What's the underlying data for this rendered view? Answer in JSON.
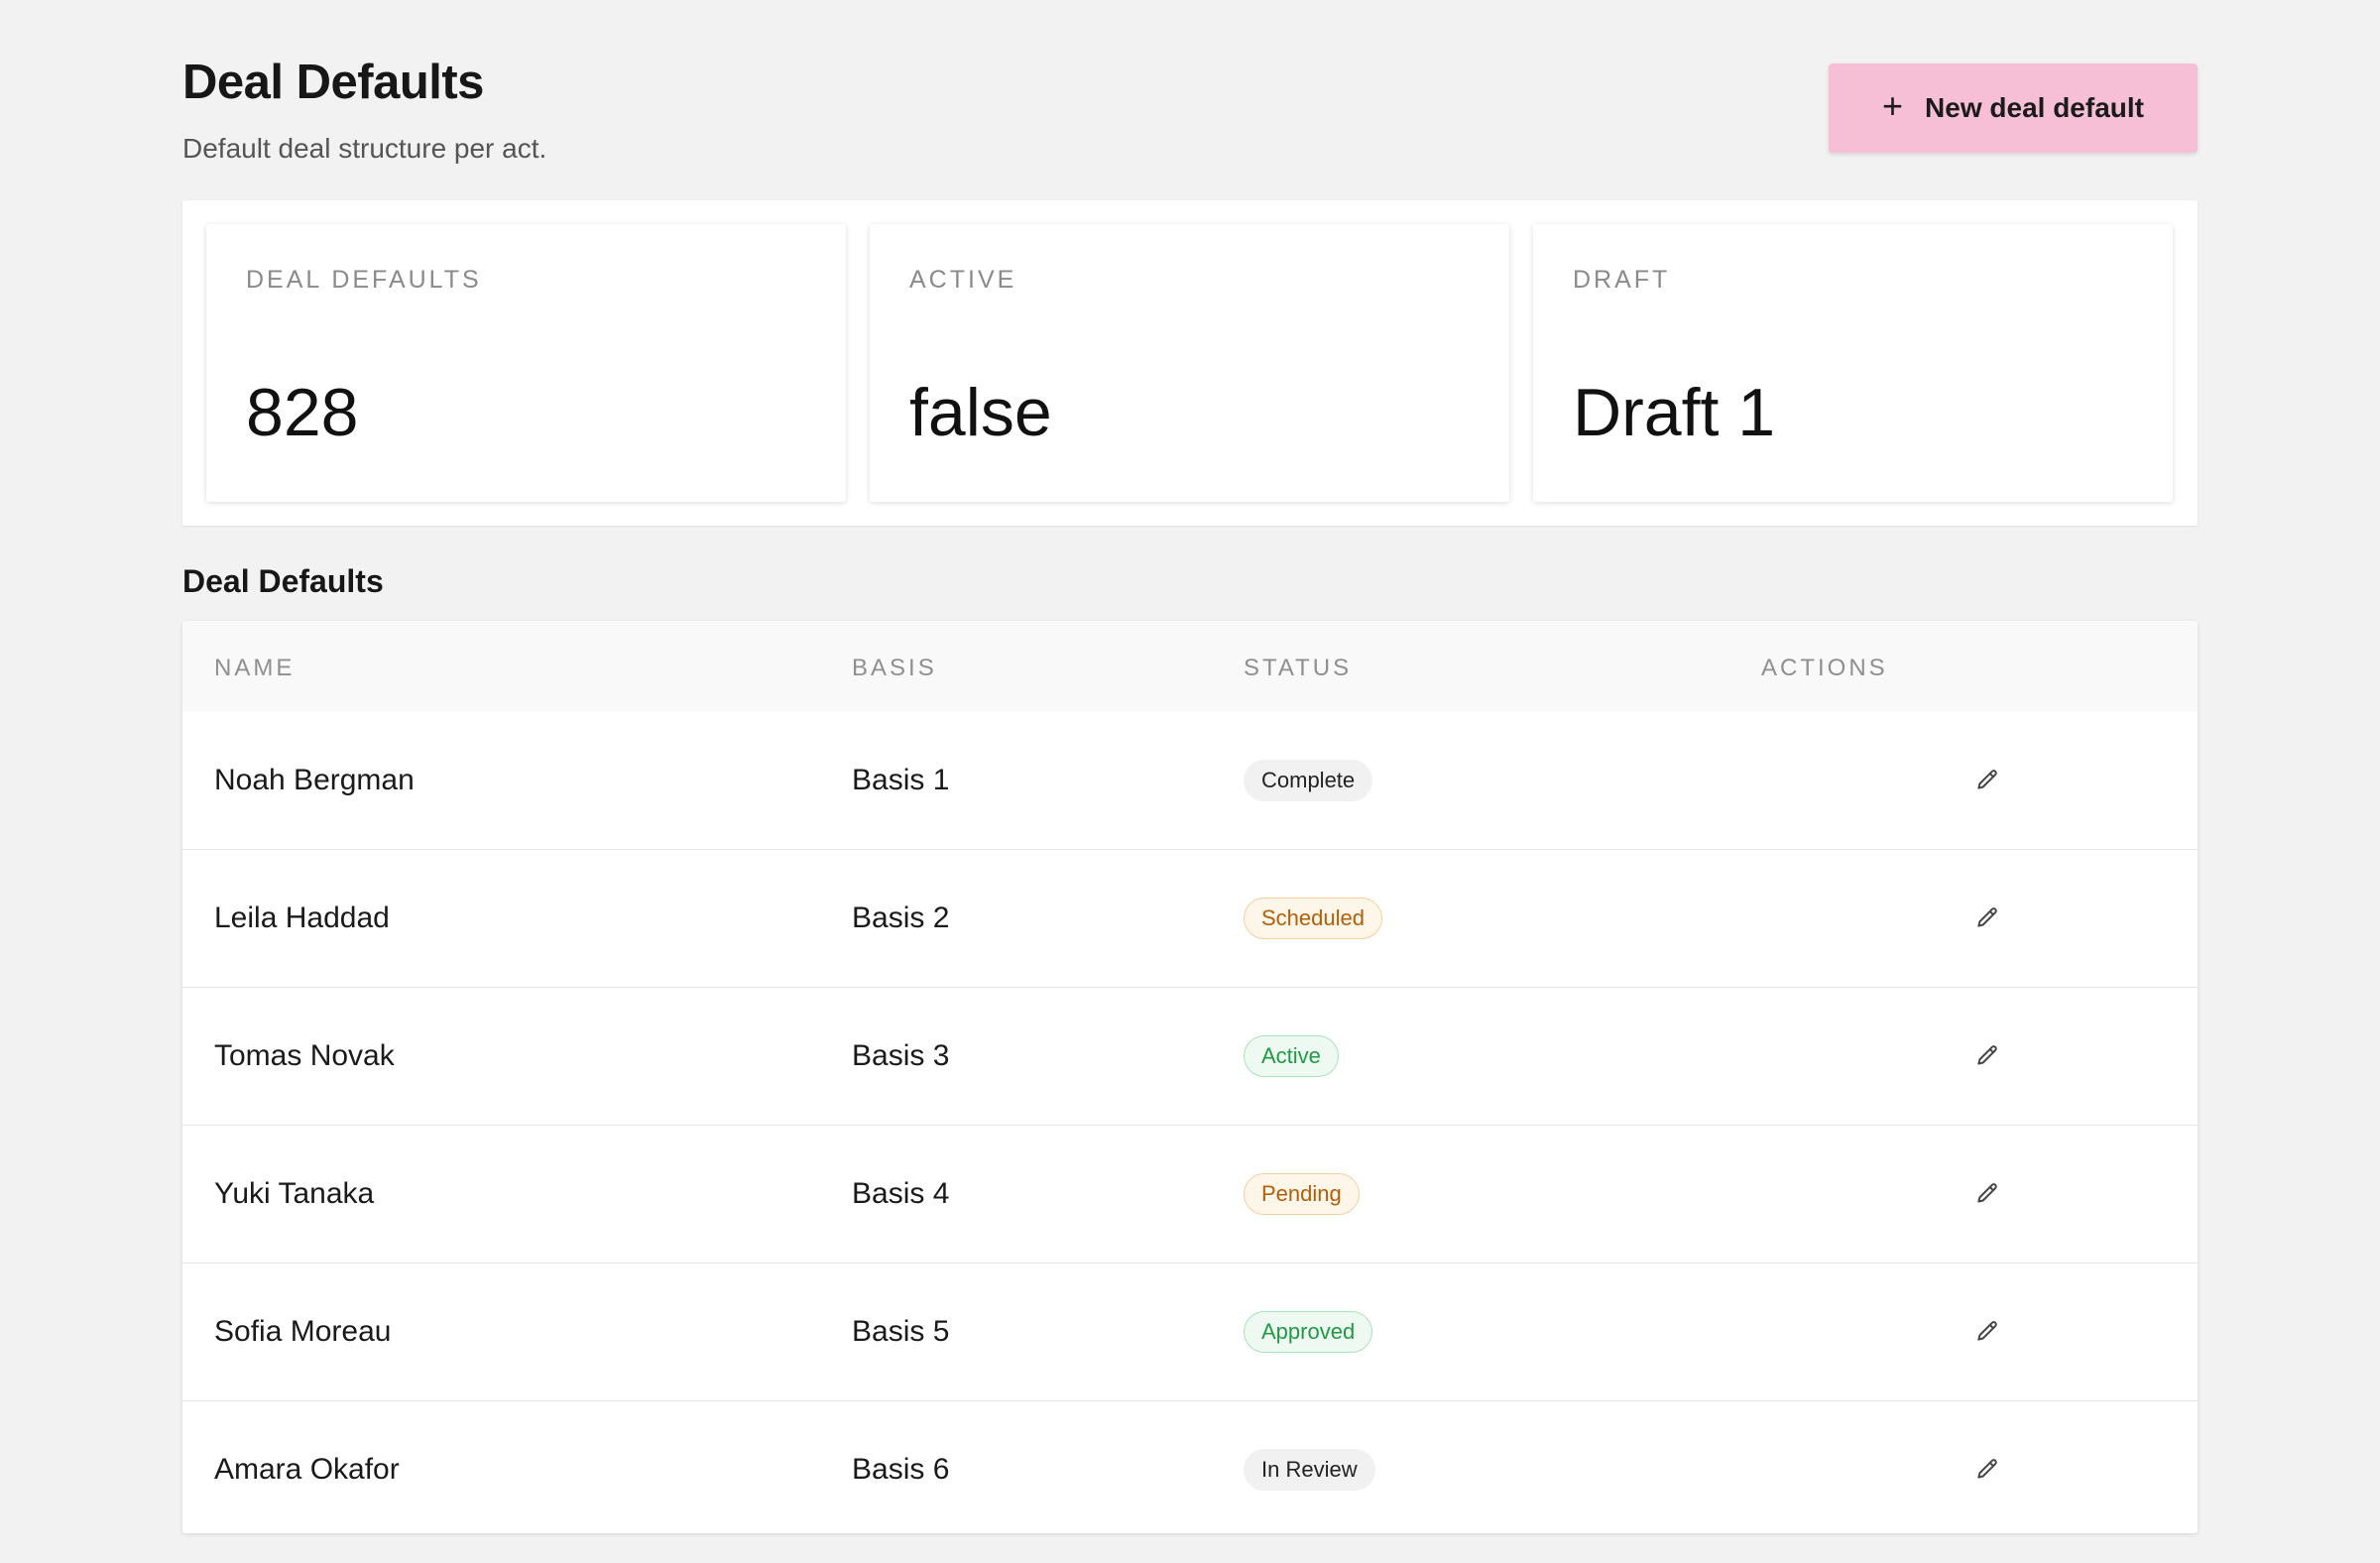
{
  "header": {
    "title": "Deal Defaults",
    "subtitle": "Default deal structure per act.",
    "new_button_label": "New deal default",
    "new_button_icon": "plus-icon",
    "accent_color": "#f6bfd6"
  },
  "stats": [
    {
      "label": "DEAL DEFAULTS",
      "value": "828"
    },
    {
      "label": "ACTIVE",
      "value": "false"
    },
    {
      "label": "DRAFT",
      "value": "Draft 1"
    }
  ],
  "table": {
    "title": "Deal Defaults",
    "columns": [
      "NAME",
      "BASIS",
      "STATUS",
      "ACTIONS"
    ],
    "rows": [
      {
        "name": "Noah Bergman",
        "basis": "Basis 1",
        "status": "Complete",
        "status_tone": "neutral",
        "action_icon": "pencil-icon"
      },
      {
        "name": "Leila Haddad",
        "basis": "Basis 2",
        "status": "Scheduled",
        "status_tone": "warn",
        "action_icon": "pencil-icon"
      },
      {
        "name": "Tomas Novak",
        "basis": "Basis 3",
        "status": "Active",
        "status_tone": "ok",
        "action_icon": "pencil-icon"
      },
      {
        "name": "Yuki Tanaka",
        "basis": "Basis 4",
        "status": "Pending",
        "status_tone": "warn",
        "action_icon": "pencil-icon"
      },
      {
        "name": "Sofia Moreau",
        "basis": "Basis 5",
        "status": "Approved",
        "status_tone": "ok",
        "action_icon": "pencil-icon"
      },
      {
        "name": "Amara Okafor",
        "basis": "Basis 6",
        "status": "In Review",
        "status_tone": "neutral",
        "action_icon": "pencil-icon"
      }
    ]
  },
  "colors": {
    "background": "#f2f2f2",
    "badge_neutral": "#f1f1f1",
    "badge_warn_text": "#b45e07",
    "badge_ok_text": "#1f9a45"
  }
}
